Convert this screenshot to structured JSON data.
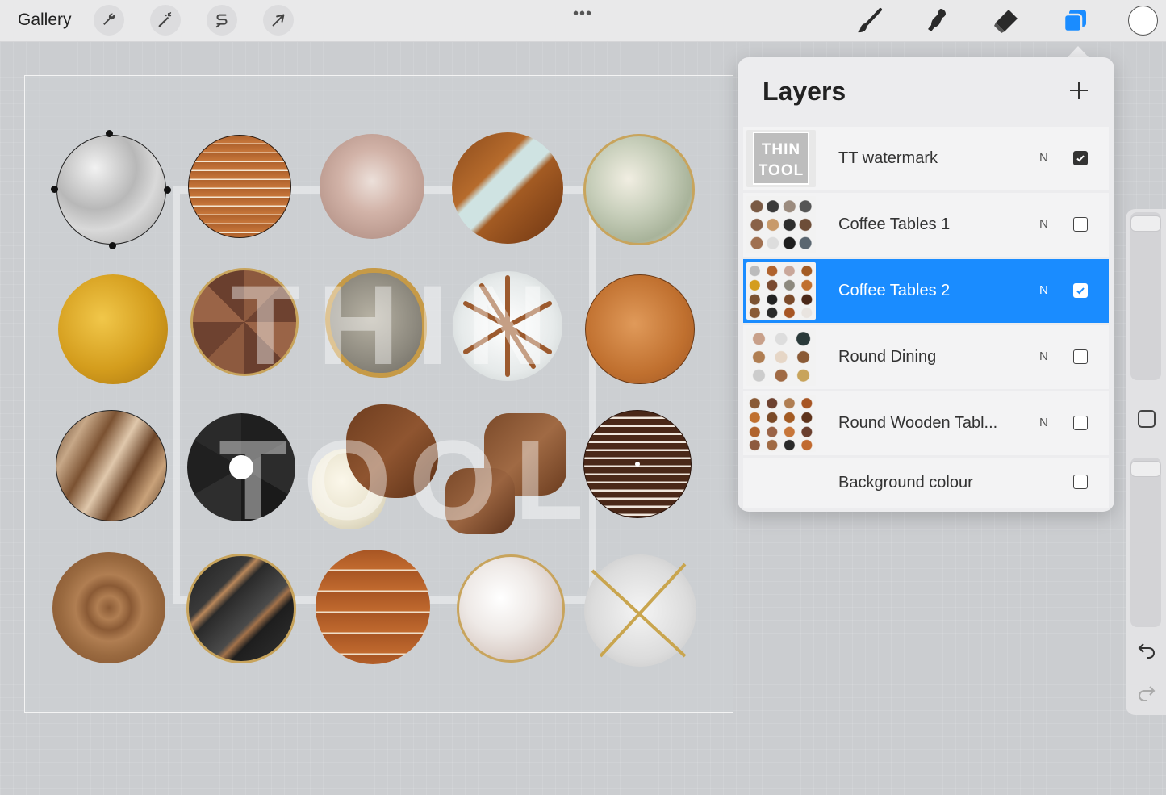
{
  "toolbar": {
    "gallery_label": "Gallery",
    "left_tools": [
      "wrench-icon",
      "magic-wand-icon",
      "selection-s-icon",
      "move-arrow-icon"
    ],
    "more_dots": "•••",
    "right_tools": [
      "brush-icon",
      "smudge-icon",
      "eraser-icon",
      "layers-icon"
    ],
    "color": "#ffffff"
  },
  "watermark": {
    "line1": "THIN",
    "line2": "TOOL"
  },
  "layers": {
    "title": "Layers",
    "accent": "#1a8cff",
    "items": [
      {
        "name": "TT watermark",
        "mode": "N",
        "visible": true,
        "thumb_line1": "THIN",
        "thumb_line2": "TOOL"
      },
      {
        "name": "Coffee Tables 1",
        "mode": "N",
        "visible": false
      },
      {
        "name": "Coffee Tables 2",
        "mode": "N",
        "visible": true,
        "active": true
      },
      {
        "name": "Round Dining",
        "mode": "N",
        "visible": false
      },
      {
        "name": "Round Wooden Tabl...",
        "mode": "N",
        "visible": false
      },
      {
        "name": "Background colour",
        "visible": false
      }
    ]
  },
  "sidebar": {
    "undo": "undo-icon",
    "redo": "redo-icon"
  }
}
